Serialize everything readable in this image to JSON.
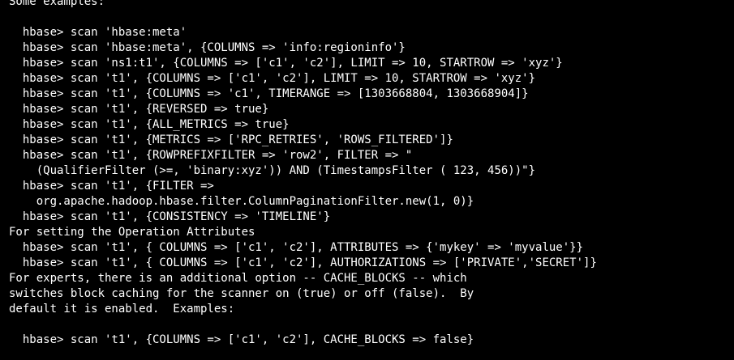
{
  "terminal": {
    "background": "#000000",
    "foreground": "#ffffff",
    "lines": [
      "Some examples:",
      "",
      "  hbase> scan 'hbase:meta'",
      "  hbase> scan 'hbase:meta', {COLUMNS => 'info:regioninfo'}",
      "  hbase> scan 'ns1:t1', {COLUMNS => ['c1', 'c2'], LIMIT => 10, STARTROW => 'xyz'}",
      "  hbase> scan 't1', {COLUMNS => ['c1', 'c2'], LIMIT => 10, STARTROW => 'xyz'}",
      "  hbase> scan 't1', {COLUMNS => 'c1', TIMERANGE => [1303668804, 1303668904]}",
      "  hbase> scan 't1', {REVERSED => true}",
      "  hbase> scan 't1', {ALL_METRICS => true}",
      "  hbase> scan 't1', {METRICS => ['RPC_RETRIES', 'ROWS_FILTERED']}",
      "  hbase> scan 't1', {ROWPREFIXFILTER => 'row2', FILTER => \"",
      "    (QualifierFilter (>=, 'binary:xyz')) AND (TimestampsFilter ( 123, 456))\"}",
      "  hbase> scan 't1', {FILTER =>",
      "    org.apache.hadoop.hbase.filter.ColumnPaginationFilter.new(1, 0)}",
      "  hbase> scan 't1', {CONSISTENCY => 'TIMELINE'}",
      "For setting the Operation Attributes",
      "  hbase> scan 't1', { COLUMNS => ['c1', 'c2'], ATTRIBUTES => {'mykey' => 'myvalue'}}",
      "  hbase> scan 't1', { COLUMNS => ['c1', 'c2'], AUTHORIZATIONS => ['PRIVATE','SECRET']}",
      "For experts, there is an additional option -- CACHE_BLOCKS -- which",
      "switches block caching for the scanner on (true) or off (false).  By",
      "default it is enabled.  Examples:",
      "",
      "  hbase> scan 't1', {COLUMNS => ['c1', 'c2'], CACHE_BLOCKS => false}"
    ]
  }
}
